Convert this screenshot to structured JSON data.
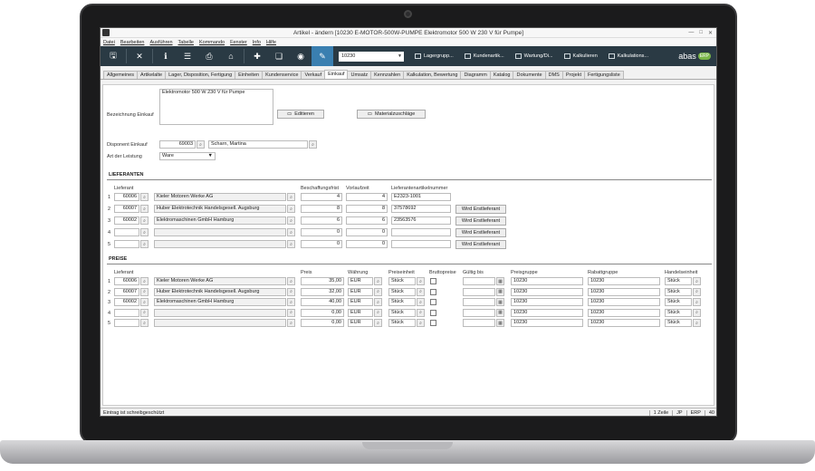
{
  "window": {
    "title": "Artikel - ändern  [10230   E-MOTOR-500W-PUMPE   Elektromotor 500 W 230 V für Pumpe]"
  },
  "menu": [
    "Datei",
    "Bearbeiten",
    "Ausführen",
    "Tabelle",
    "Kommando",
    "Fenster",
    "Info",
    "Hilfe"
  ],
  "toolbar": {
    "icons": [
      "save-icon",
      "close-icon",
      "info-icon",
      "list-icon",
      "print-icon",
      "home-icon",
      "add-icon",
      "copy-icon",
      "view-icon",
      "edit-icon"
    ],
    "combo_value": "10230",
    "links": [
      "Lagergrupp...",
      "Kundenartik...",
      "Wartung/Di...",
      "Kalkulieren",
      "Kalkulations..."
    ],
    "logo": "abas",
    "logo_badge": "ERP"
  },
  "tabs": [
    "Allgemeines",
    "Artikelalte",
    "Lager, Disposition, Fertigung",
    "Einheiten",
    "Kundenservice",
    "Verkauf",
    "Einkauf",
    "Umsatz",
    "Kennzahlen",
    "Kalkulation, Bewertung",
    "Diagramm",
    "Katalog",
    "Dokumente",
    "DMS",
    "Projekt",
    "Fertigungsliste"
  ],
  "active_tab": "Einkauf",
  "head": {
    "bezeichnung_label": "Bezeichnung Einkauf",
    "bezeichnung_value": "Elektromotor 500 W 230 V für Pumpe",
    "editieren": "Editieren",
    "materialzuschlaege": "Materialzuschläge",
    "disponent_label": "Disponent Einkauf",
    "disponent_nr": "69003",
    "disponent_name": "Scharn, Martina",
    "art_label": "Art der Leistung",
    "art_value": "Ware"
  },
  "lieferanten": {
    "title": "LIEFERANTEN",
    "headers": [
      "Lieferant",
      "Beschaffungsfrist",
      "Vorlaufzeit",
      "Lieferantenartikelnummer"
    ],
    "rows": [
      {
        "n": "1",
        "nr": "60006",
        "name": "Kieler Motoren Werke AG",
        "frist": "4",
        "vorlauf": "4",
        "artnr": "E2323-1001",
        "btn": ""
      },
      {
        "n": "2",
        "nr": "60007",
        "name": "Huber Elektrotechnik Handelsgesell. Augsburg",
        "frist": "8",
        "vorlauf": "8",
        "artnr": "37578692",
        "btn": "Wird Erstlieferant"
      },
      {
        "n": "3",
        "nr": "60002",
        "name": "Elektromaschinen GmbH Hamburg",
        "frist": "6",
        "vorlauf": "6",
        "artnr": "23563576",
        "btn": "Wird Erstlieferant"
      },
      {
        "n": "4",
        "nr": "",
        "name": "",
        "frist": "0",
        "vorlauf": "0",
        "artnr": "",
        "btn": "Wird Erstlieferant"
      },
      {
        "n": "5",
        "nr": "",
        "name": "",
        "frist": "0",
        "vorlauf": "0",
        "artnr": "",
        "btn": "Wird Erstlieferant"
      }
    ]
  },
  "preise": {
    "title": "PREISE",
    "headers": [
      "Lieferant",
      "Preis",
      "Währung",
      "Preiseinheit",
      "Bruttopreise",
      "Gültig bis",
      "Preisgruppe",
      "Rabattgruppe",
      "Handelseinheit"
    ],
    "rows": [
      {
        "n": "1",
        "nr": "60006",
        "name": "Kieler Motoren Werke AG",
        "preis": "35,00",
        "waehrung": "EUR",
        "einheit": "Stück",
        "gruppe": "10230",
        "rabatt": "10230",
        "handel": "Stück"
      },
      {
        "n": "2",
        "nr": "60007",
        "name": "Huber Elektrotechnik Handelsgesell. Augsburg",
        "preis": "32,00",
        "waehrung": "EUR",
        "einheit": "Stück",
        "gruppe": "10230",
        "rabatt": "10230",
        "handel": "Stück"
      },
      {
        "n": "3",
        "nr": "60002",
        "name": "Elektromaschinen GmbH Hamburg",
        "preis": "40,00",
        "waehrung": "EUR",
        "einheit": "Stück",
        "gruppe": "10230",
        "rabatt": "10230",
        "handel": "Stück"
      },
      {
        "n": "4",
        "nr": "",
        "name": "",
        "preis": "0,00",
        "waehrung": "EUR",
        "einheit": "Stück",
        "gruppe": "10230",
        "rabatt": "10230",
        "handel": "Stück"
      },
      {
        "n": "5",
        "nr": "",
        "name": "",
        "preis": "0,00",
        "waehrung": "EUR",
        "einheit": "Stück",
        "gruppe": "10230",
        "rabatt": "10230",
        "handel": "Stück"
      }
    ]
  },
  "status": {
    "message": "Eintrag ist schreibgeschützt",
    "cells": [
      "1 Zeile",
      "JP",
      "ERP",
      "40"
    ]
  }
}
